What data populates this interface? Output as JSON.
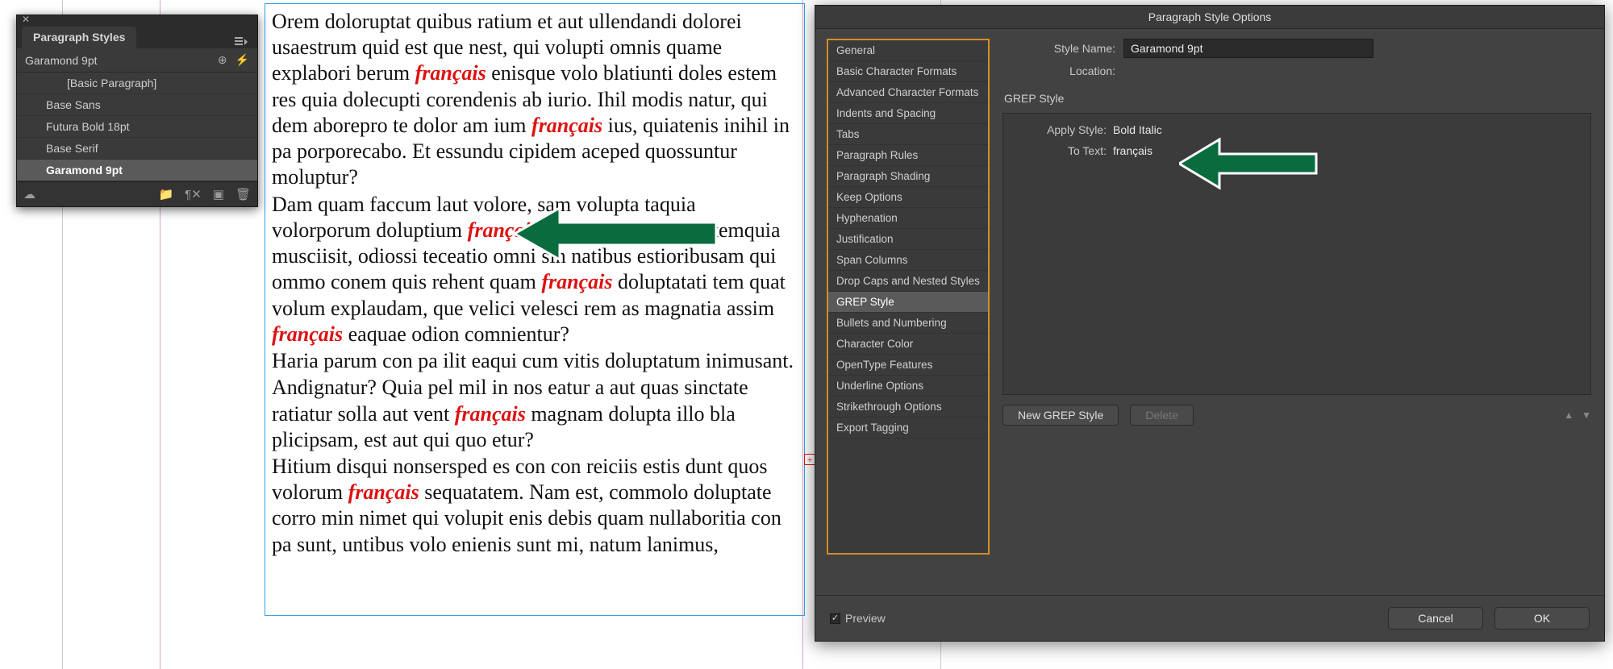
{
  "panel": {
    "title": "Paragraph Styles",
    "current": "Garamond 9pt",
    "items": [
      {
        "label": "[Basic Paragraph]",
        "lev": 1
      },
      {
        "label": "Base Sans",
        "lev": 0
      },
      {
        "label": "Futura Bold 18pt",
        "lev": 0
      },
      {
        "label": "Base Serif",
        "lev": 0
      },
      {
        "label": "Garamond 9pt",
        "lev": 0,
        "selected": true
      }
    ]
  },
  "doc": {
    "grep_word": "français",
    "overset": "+",
    "para1_a": "Orem doloruptat quibus ratium et aut ullendandi dolorei usaestrum quid est que nest, qui volupti omnis quame explabori berum ",
    "para1_b": " enisque volo blatiunti doles estem res quia dolecupti corendenis ab iurio. Ihil modis natur, qui dem aborepro te dolor am ium ",
    "para1_c": " ius, quiatenis inihil in pa porporecabo. Et essundu cipidem aceped quossuntur moluptur?",
    "para2_a": "Dam quam faccum laut volore, sam volupta taquia volorporum doluptium ",
    "para2_b": " modi temquia musciisit, odiossi teceatio omni sin natibus estioribusam qui ommo conem quis rehent quam ",
    "para2_c": " doluptatati tem quat volum explaudam, que velici velesci rem as magnatia assim ",
    "para2_d": " eaquae odion comnientur?",
    "para3": "Haria parum con pa ilit eaqui cum vitis doluptatum inimusant.",
    "para4_a": "Andignatur? Quia pel mil in nos eatur a aut quas sinctate ratiatur solla aut vent ",
    "para4_b": " magnam dolupta illo bla plicipsam, est aut qui quo etur?",
    "para5_a": "Hitium disqui nonsersped es con con reiciis estis dunt quos volorum ",
    "para5_b": " sequatatem. Nam est, commolo doluptate corro min nimet qui volupit enis debis quam nullaboritia con pa sunt, untibus volo enienis sunt mi, natum lanimus,"
  },
  "dialog": {
    "title": "Paragraph Style Options",
    "style_name_label": "Style Name:",
    "style_name_value": "Garamond 9pt",
    "location_label": "Location:",
    "section_title": "GREP Style",
    "categories": [
      "General",
      "Basic Character Formats",
      "Advanced Character Formats",
      "Indents and Spacing",
      "Tabs",
      "Paragraph Rules",
      "Paragraph Shading",
      "Keep Options",
      "Hyphenation",
      "Justification",
      "Span Columns",
      "Drop Caps and Nested Styles",
      "GREP Style",
      "Bullets and Numbering",
      "Character Color",
      "OpenType Features",
      "Underline Options",
      "Strikethrough Options",
      "Export Tagging"
    ],
    "selected_category": "GREP Style",
    "apply_style_label": "Apply Style:",
    "apply_style_value": "Bold Italic",
    "to_text_label": "To Text:",
    "to_text_value": "français",
    "new_btn": "New GREP Style",
    "delete_btn": "Delete",
    "preview_label": "Preview",
    "cancel": "Cancel",
    "ok": "OK"
  },
  "arrow_color": "#0a6b3f"
}
